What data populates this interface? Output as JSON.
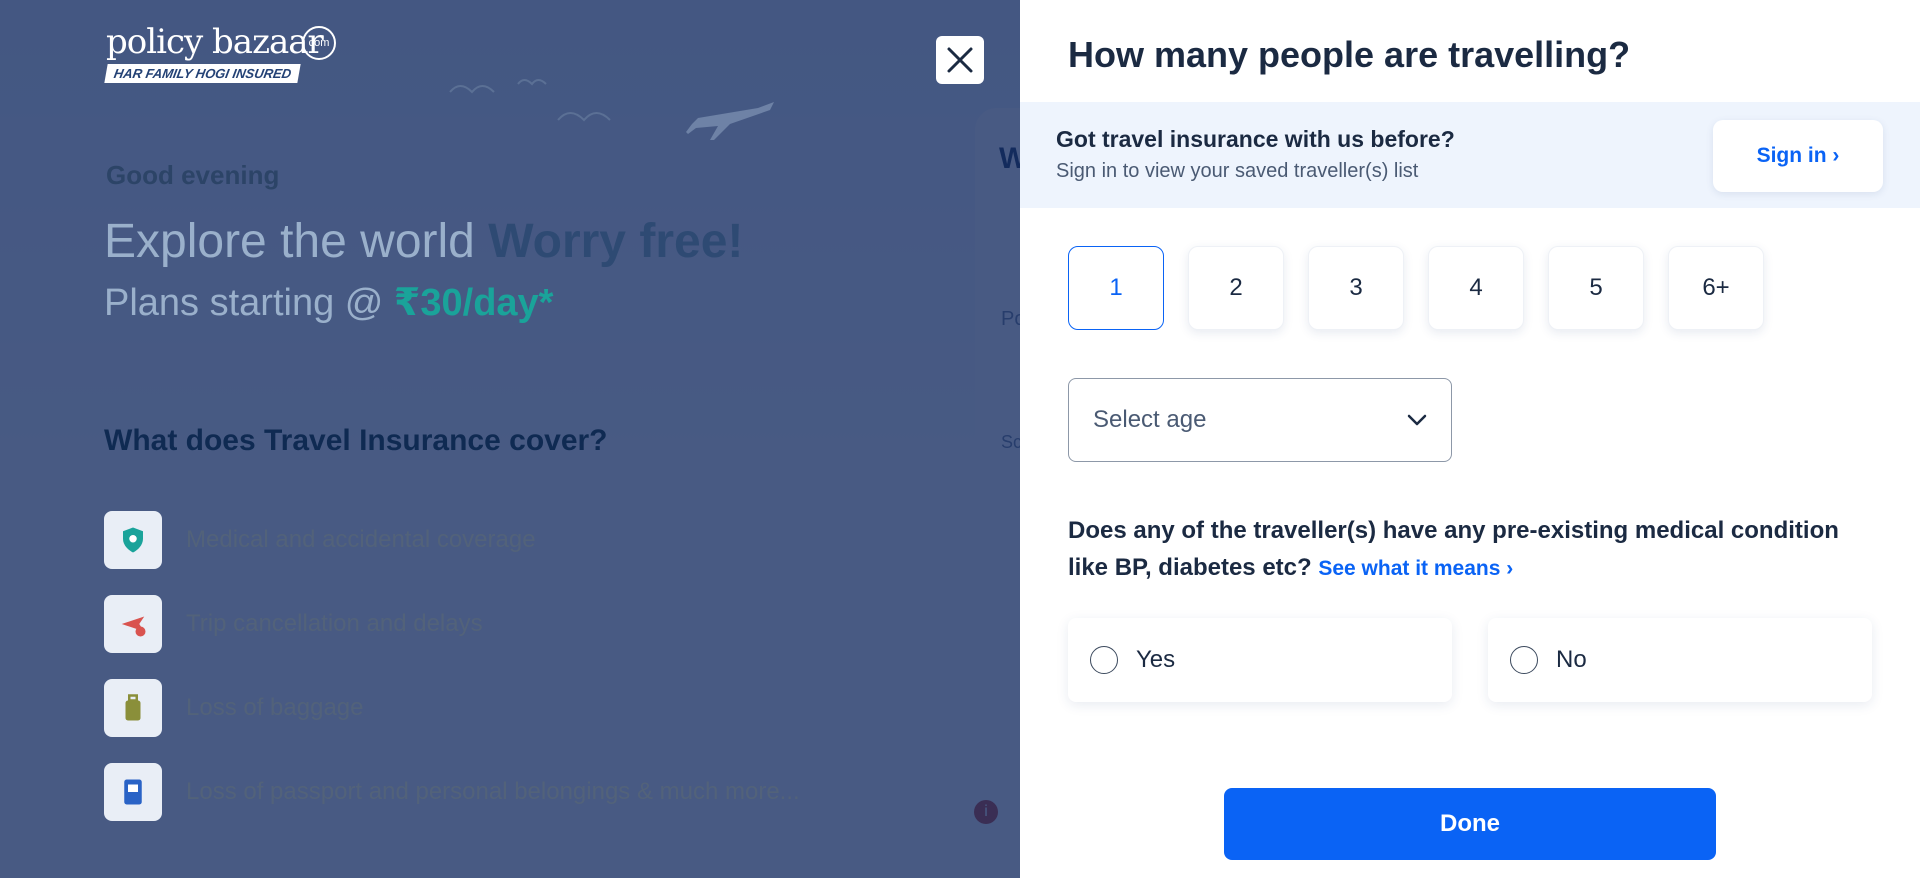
{
  "background": {
    "logo": {
      "wordmark": "policy bazaar",
      "com": "com",
      "tagline": "HAR FAMILY HOGI INSURED"
    },
    "greeting": "Good evening",
    "headline_light": "Explore the world ",
    "headline_bold": "Worry free!",
    "plans_prefix": "Plans starting @ ",
    "plans_price": "₹30/day*",
    "cover_title": "What does Travel Insurance cover?",
    "cover_items": [
      {
        "label": "Medical and accidental coverage",
        "icon": "shield-icon"
      },
      {
        "label": "Trip cancellation and delays",
        "icon": "plane-cancel-icon"
      },
      {
        "label": "Loss of baggage",
        "icon": "baggage-icon"
      },
      {
        "label": "Loss of passport and personal belongings & much more...",
        "icon": "passport-icon"
      }
    ],
    "card_heading": "W",
    "card_label1": "Po",
    "card_label2": "Sc",
    "info_badge": "i"
  },
  "drawer": {
    "title": "How many people are travelling?",
    "signin": {
      "question": "Got travel insurance with us before?",
      "subtitle": "Sign in to view your saved traveller(s) list",
      "button": "Sign in ›"
    },
    "traveller_counts": [
      "1",
      "2",
      "3",
      "4",
      "5",
      "6+"
    ],
    "selected_count": "1",
    "age_select": {
      "placeholder": "Select age"
    },
    "medical_question": "Does any of the traveller(s) have any pre-existing medical condition like BP, diabetes etc?",
    "medical_link": "See what it means ›",
    "options": {
      "yes": "Yes",
      "no": "No"
    },
    "done_button": "Done"
  },
  "colors": {
    "primary": "#0a63f5",
    "overlay": "#142c60",
    "text_dark": "#1b2a42",
    "banner_bg": "#eef4fd"
  }
}
